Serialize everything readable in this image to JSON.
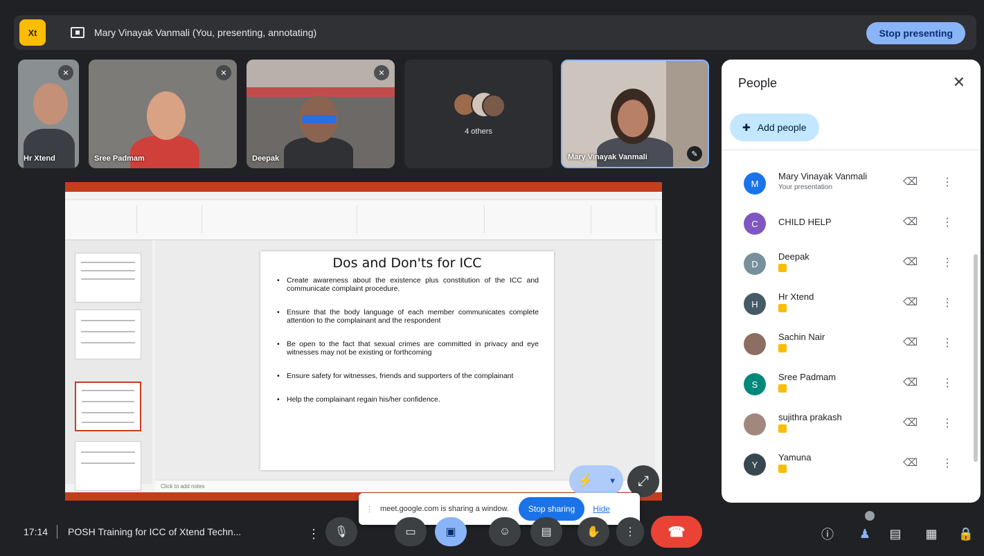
{
  "colors": {
    "background": "#202124",
    "accent": "#8ab4f8",
    "leave": "#ea4335",
    "ppt_brand": "#c43e1c"
  },
  "top_bar": {
    "logo_text": "Xt",
    "presenting_label": "Mary Vinayak Vanmali (You, presenting, annotating)",
    "stop_presenting": "Stop presenting"
  },
  "tiles": [
    {
      "name": "Hr Xtend",
      "icon": "mic-off-icon"
    },
    {
      "name": "Sree Padmam",
      "icon": "mic-off-icon"
    },
    {
      "name": "Deepak",
      "icon": "mic-off-icon"
    },
    {
      "name": "4 others",
      "icon": "group-avatars"
    },
    {
      "name": "Mary Vinayak Vanmali",
      "icon": "pen-annotate-icon"
    }
  ],
  "slide": {
    "title": "Dos and Don'ts for ICC",
    "bullets": [
      "Create awareness about the existence plus constitution of the ICC and communicate complaint procedure.",
      "Ensure that the body language of each member communicates complete attention to the complainant and the respondent",
      "Be open to the fact that sexual crimes are committed in privacy and eye witnesses may not be existing or forthcoming",
      "Ensure safety for witnesses, friends and supporters of the complainant",
      "Help the complainant regain his/her confidence."
    ],
    "notes_placeholder": "Click to add notes"
  },
  "share_banner": {
    "text": "meet.google.com is sharing a window.",
    "stop_sharing": "Stop sharing",
    "hide": "Hide"
  },
  "bottom_bar": {
    "time": "17:14",
    "meeting_title": "POSH Training for ICC of Xtend Techn..."
  },
  "people_panel": {
    "title": "People",
    "add_people": "Add people",
    "participants": [
      {
        "name": "Mary Vinayak Vanmali",
        "sub": "Your presentation",
        "initial": "M",
        "color": "#1a73e8",
        "status": "presenting"
      },
      {
        "name": "CHILD HELP",
        "sub": "",
        "initial": "C",
        "color": "#7e57c2",
        "status": "muted"
      },
      {
        "name": "Deepak",
        "sub": "",
        "initial": "D",
        "color": "#78909c",
        "status": "muted"
      },
      {
        "name": "Hr Xtend",
        "sub": "",
        "initial": "H",
        "color": "#455a64",
        "status": "muted"
      },
      {
        "name": "Sachin Nair",
        "sub": "",
        "initial": "",
        "color": "#8d6e63",
        "status": "muted"
      },
      {
        "name": "Sree Padmam",
        "sub": "",
        "initial": "S",
        "color": "#00897b",
        "status": "muted"
      },
      {
        "name": "sujithra prakash",
        "sub": "",
        "initial": "",
        "color": "#a1887f",
        "status": "muted"
      },
      {
        "name": "Yamuna",
        "sub": "",
        "initial": "Y",
        "color": "#37474f",
        "status": "muted"
      }
    ]
  }
}
